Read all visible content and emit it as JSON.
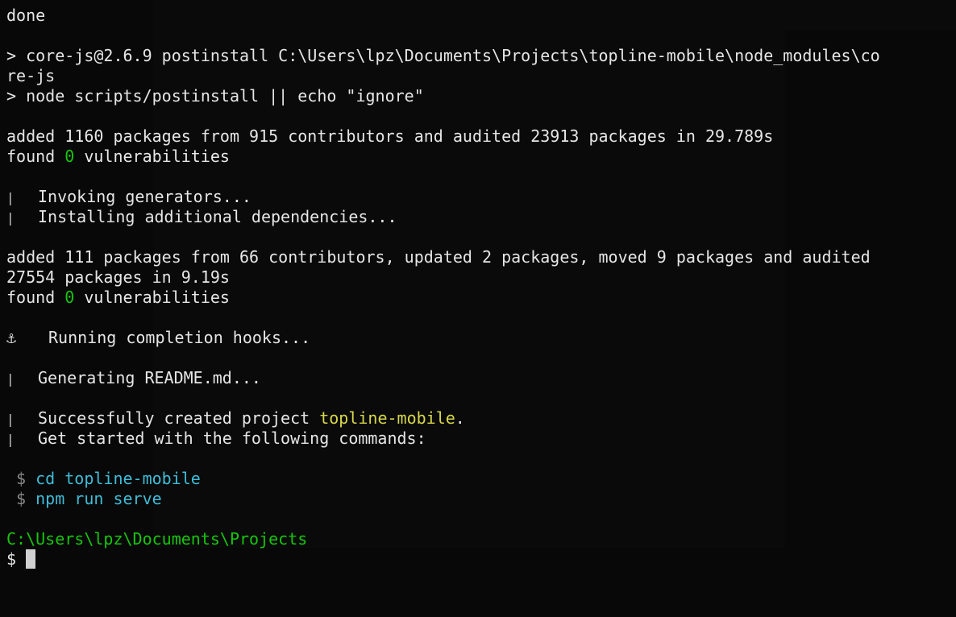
{
  "terminal": {
    "lines": {
      "l0": "done",
      "l1": "",
      "l2": "> core-js@2.6.9 postinstall C:\\Users\\lpz\\Documents\\Projects\\topline-mobile\\node_modules\\co",
      "l3": "re-js",
      "l4": "> node scripts/postinstall || echo \"ignore\"",
      "l5": "",
      "l6": "added 1160 packages from 915 contributors and audited 23913 packages in 29.789s",
      "l7_prefix": "found ",
      "l7_count": "0",
      "l7_suffix": " vulnerabilities",
      "l8": "",
      "l9": "Invoking generators...",
      "l10": "Installing additional dependencies...",
      "l11": "",
      "l12": "added 111 packages from 66 contributors, updated 2 packages, moved 9 packages and audited",
      "l13": "27554 packages in 9.19s",
      "l14_prefix": "found ",
      "l14_count": "0",
      "l14_suffix": " vulnerabilities",
      "l15": "",
      "l16_icon": "⚓",
      "l16": "Running completion hooks...",
      "l17": "",
      "l18": "Generating README.md...",
      "l19": "",
      "l20_prefix": "Successfully created project ",
      "l20_project": "topline-mobile",
      "l20_suffix": ".",
      "l21": "Get started with the following commands:",
      "l22": "",
      "l23_prompt": "$",
      "l23_cmd": "cd topline-mobile",
      "l24_prompt": "$",
      "l24_cmd": "npm run serve",
      "l25": "",
      "l26_path": "C:\\Users\\lpz\\Documents\\Projects",
      "l27_prompt": "$"
    },
    "bar_glyph": "|",
    "colors": {
      "background": "#0c0c0c",
      "text": "#e6e6e6",
      "green": "#16c60c",
      "yellow": "#d8d84a",
      "cyan": "#3fbcd8"
    }
  }
}
